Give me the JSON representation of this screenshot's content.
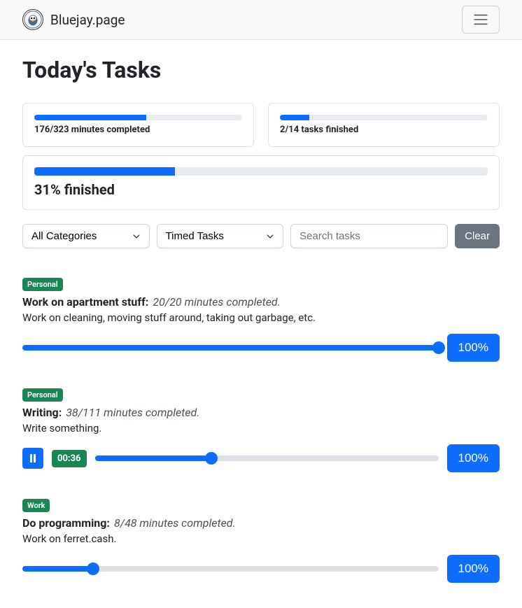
{
  "brand": "Bluejay.page",
  "page_title": "Today's Tasks",
  "stats": {
    "minutes": {
      "label": "176/323 minutes completed",
      "pct": 54
    },
    "tasks": {
      "label": "2/14 tasks finished",
      "pct": 14
    },
    "overall": {
      "label": "31% finished",
      "pct": 31
    }
  },
  "filters": {
    "category": "All Categories",
    "type": "Timed Tasks",
    "search_placeholder": "Search tasks",
    "clear_label": "Clear"
  },
  "tasks": [
    {
      "category": "Personal",
      "title": "Work on apartment stuff:",
      "time": "20/20 minutes completed.",
      "desc": "Work on cleaning, moving stuff around, taking out garbage, etc.",
      "pct": 100,
      "pct_label": "100%",
      "running": false
    },
    {
      "category": "Personal",
      "title": "Writing:",
      "time": "38/111 minutes completed.",
      "desc": "Write something.",
      "pct": 34,
      "pct_label": "100%",
      "running": true,
      "timer": "00:36"
    },
    {
      "category": "Work",
      "title": "Do programming:",
      "time": "8/48 minutes completed.",
      "desc": "Work on ferret.cash.",
      "pct": 17,
      "pct_label": "100%",
      "running": false
    }
  ]
}
